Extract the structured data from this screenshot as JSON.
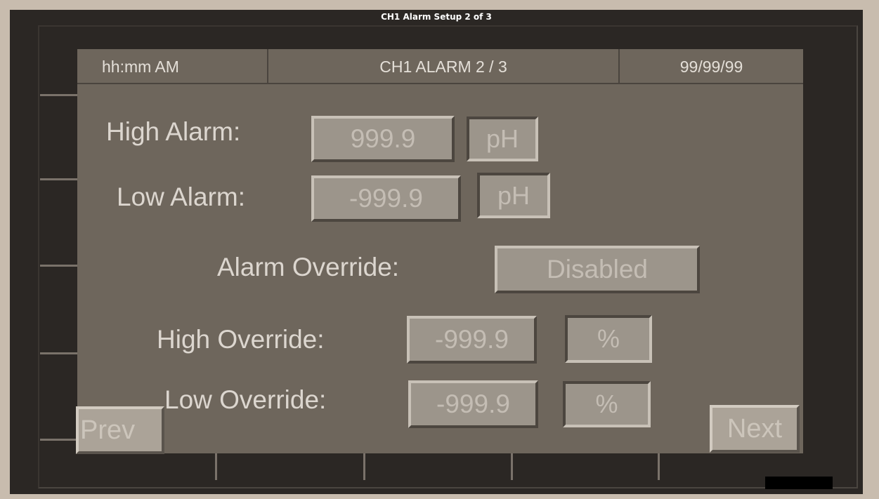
{
  "window": {
    "title": "CH1 Alarm Setup 2 of 3"
  },
  "header": {
    "time": "hh:mm AM",
    "title": "CH1 ALARM 2 / 3",
    "date": "99/99/99"
  },
  "fields": {
    "high_alarm": {
      "label": "High Alarm:",
      "value": "999.9",
      "unit": "pH"
    },
    "low_alarm": {
      "label": "Low Alarm:",
      "value": "-999.9",
      "unit": "pH"
    },
    "alarm_override": {
      "label": "Alarm Override:",
      "value": "Disabled"
    },
    "high_override": {
      "label": "High Override:",
      "value": "-999.9",
      "unit": "%"
    },
    "low_override": {
      "label": "Low Override:",
      "value": "-999.9",
      "unit": "%"
    }
  },
  "nav": {
    "prev": "Prev",
    "next": "Next"
  },
  "colors": {
    "background": "#c8bcae",
    "bezel": "#2b2724",
    "screen": "#6e665c",
    "button": "#9c958b",
    "text": "#dcd6cf"
  }
}
